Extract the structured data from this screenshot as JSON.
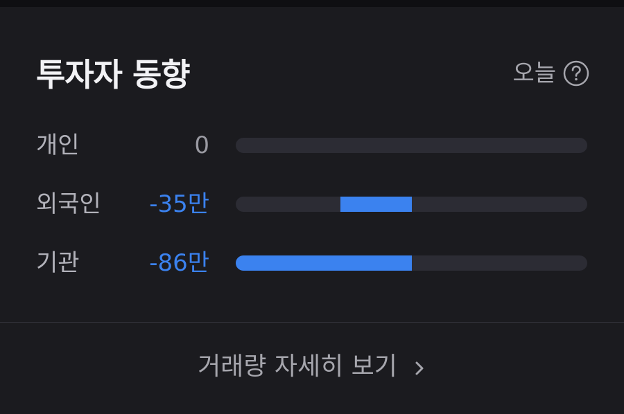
{
  "header": {
    "title": "투자자 동향",
    "period_label": "오늘",
    "help_icon": "question-circle-icon"
  },
  "investors": [
    {
      "label": "개인",
      "value": "0",
      "tone": "neutral",
      "bar_fraction": 0.0
    },
    {
      "label": "외국인",
      "value": "-35만",
      "tone": "negative",
      "bar_fraction": 0.407
    },
    {
      "label": "기관",
      "value": "-86만",
      "tone": "negative",
      "bar_fraction": 1.0
    }
  ],
  "footer": {
    "link_label": "거래량 자세히 보기",
    "chevron_icon": "chevron-right-icon"
  },
  "colors": {
    "background": "#1b1b1f",
    "negative": "#3b82ef",
    "track": "#2c2c34",
    "text_primary": "#f2f2f5",
    "text_secondary": "#a6a6ad"
  }
}
